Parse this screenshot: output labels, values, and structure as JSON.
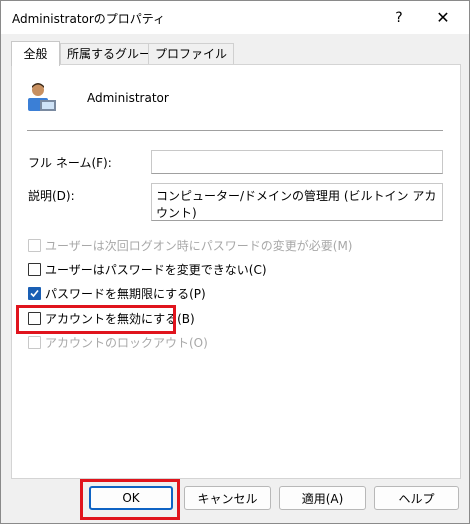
{
  "window": {
    "title": "Administratorのプロパティ",
    "help_glyph": "?",
    "close_glyph": "✕"
  },
  "tabs": [
    {
      "label": "全般",
      "active": true
    },
    {
      "label": "所属するグループ",
      "active": false
    },
    {
      "label": "プロファイル",
      "active": false
    }
  ],
  "user": {
    "name": "Administrator",
    "icon": "user-icon"
  },
  "fields": {
    "fullname_label": "フル ネーム(F):",
    "fullname_value": "",
    "description_label": "説明(D):",
    "description_value": "コンピューター/ドメインの管理用 (ビルトイン アカウント)"
  },
  "checkboxes": [
    {
      "label": "ユーザーは次回ログオン時にパスワードの変更が必要(M)",
      "checked": false,
      "enabled": false
    },
    {
      "label": "ユーザーはパスワードを変更できない(C)",
      "checked": false,
      "enabled": true
    },
    {
      "label": "パスワードを無期限にする(P)",
      "checked": true,
      "enabled": true
    },
    {
      "label": "アカウントを無効にする(B)",
      "checked": false,
      "enabled": true
    },
    {
      "label": "アカウントのロックアウト(O)",
      "checked": false,
      "enabled": false
    }
  ],
  "buttons": {
    "ok": "OK",
    "cancel": "キャンセル",
    "apply": "適用(A)",
    "help": "ヘルプ"
  },
  "colors": {
    "highlight": "#e0141d",
    "accent": "#1a5fb4"
  }
}
